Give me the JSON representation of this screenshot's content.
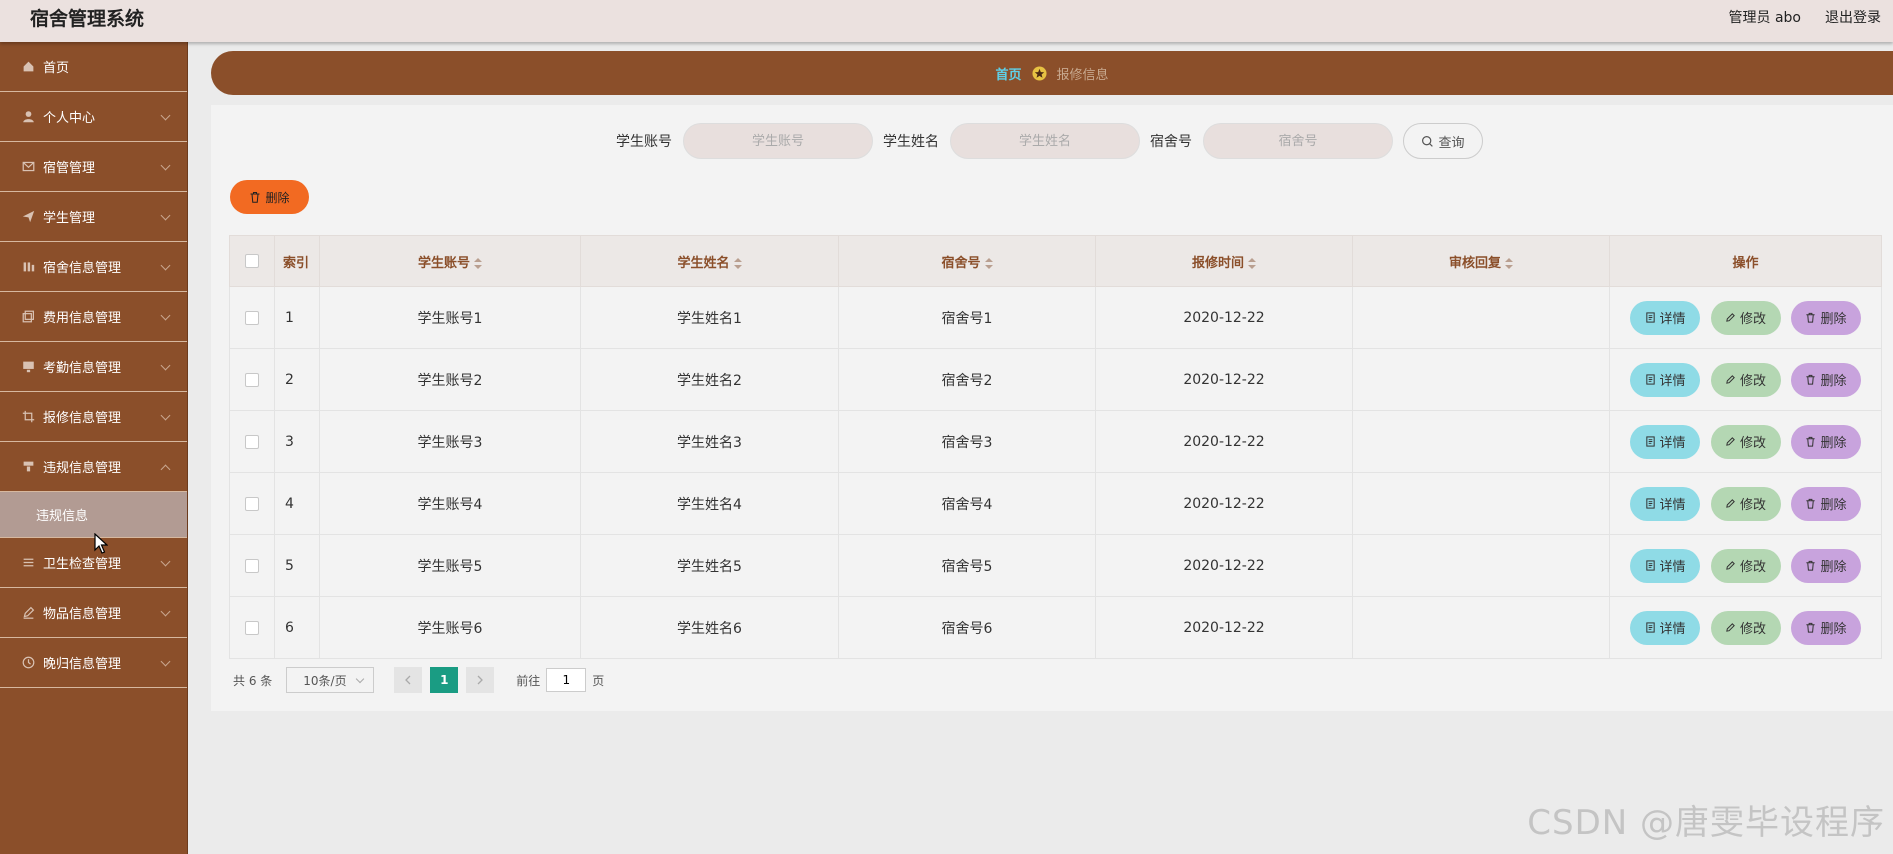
{
  "header": {
    "app_title": "宿舍管理系统",
    "admin_label": "管理员 abo",
    "logout_label": "退出登录"
  },
  "sidebar": {
    "items": [
      {
        "label": "首页",
        "icon": "home-icon"
      },
      {
        "label": "个人中心",
        "icon": "user-icon"
      },
      {
        "label": "宿管管理",
        "icon": "mail-icon"
      },
      {
        "label": "学生管理",
        "icon": "send-icon"
      },
      {
        "label": "宿舍信息管理",
        "icon": "chart-icon"
      },
      {
        "label": "费用信息管理",
        "icon": "copy-icon"
      },
      {
        "label": "考勤信息管理",
        "icon": "monitor-icon"
      },
      {
        "label": "报修信息管理",
        "icon": "crop-icon"
      },
      {
        "label": "违规信息管理",
        "icon": "tag-icon"
      },
      {
        "label": "卫生检查管理",
        "icon": "list-icon"
      },
      {
        "label": "物品信息管理",
        "icon": "edit-outline-icon"
      },
      {
        "label": "晚归信息管理",
        "icon": "clock-icon"
      }
    ],
    "sub_item": "违规信息"
  },
  "breadcrumb": {
    "home": "首页",
    "current": "报修信息"
  },
  "search": {
    "fields": [
      {
        "label": "学生账号",
        "placeholder": "学生账号"
      },
      {
        "label": "学生姓名",
        "placeholder": "学生姓名"
      },
      {
        "label": "宿舍号",
        "placeholder": "宿舍号"
      }
    ],
    "query_label": "查询"
  },
  "toolbar": {
    "delete_label": "删除"
  },
  "table": {
    "headers": [
      "索引",
      "学生账号",
      "学生姓名",
      "宿舍号",
      "报修时间",
      "审核回复",
      "操作"
    ],
    "rows": [
      {
        "index": "1",
        "account": "学生账号1",
        "name": "学生姓名1",
        "dorm": "宿舍号1",
        "time": "2020-12-22",
        "reply": ""
      },
      {
        "index": "2",
        "account": "学生账号2",
        "name": "学生姓名2",
        "dorm": "宿舍号2",
        "time": "2020-12-22",
        "reply": ""
      },
      {
        "index": "3",
        "account": "学生账号3",
        "name": "学生姓名3",
        "dorm": "宿舍号3",
        "time": "2020-12-22",
        "reply": ""
      },
      {
        "index": "4",
        "account": "学生账号4",
        "name": "学生姓名4",
        "dorm": "宿舍号4",
        "time": "2020-12-22",
        "reply": ""
      },
      {
        "index": "5",
        "account": "学生账号5",
        "name": "学生姓名5",
        "dorm": "宿舍号5",
        "time": "2020-12-22",
        "reply": ""
      },
      {
        "index": "6",
        "account": "学生账号6",
        "name": "学生姓名6",
        "dorm": "宿舍号6",
        "time": "2020-12-22",
        "reply": ""
      }
    ],
    "actions": {
      "detail": "详情",
      "edit": "修改",
      "delete": "删除"
    }
  },
  "pagination": {
    "total_label": "共 6 条",
    "page_size": "10条/页",
    "current_page": "1",
    "goto_label": "前往",
    "goto_value": "1",
    "page_suffix": "页"
  },
  "watermark": "CSDN @唐雯毕设程序",
  "colors": {
    "sidebar_bg": "#8b4f2a",
    "topbar_bg": "#ebe1df",
    "accent_orange": "#f26a22",
    "detail_btn": "#8fdbe6",
    "edit_btn": "#b4d7b3",
    "delete_btn": "#c8a3dd",
    "active_page": "#1a9c83"
  }
}
